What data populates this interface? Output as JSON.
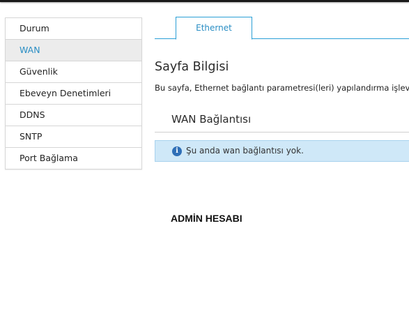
{
  "sidebar": {
    "items": [
      {
        "label": "Durum",
        "active": false
      },
      {
        "label": "WAN",
        "active": true
      },
      {
        "label": "Güvenlik",
        "active": false
      },
      {
        "label": "Ebeveyn Denetimleri",
        "active": false
      },
      {
        "label": "DDNS",
        "active": false
      },
      {
        "label": "SNTP",
        "active": false
      },
      {
        "label": "Port Bağlama",
        "active": false
      }
    ]
  },
  "tabs": [
    {
      "label": "Ethernet",
      "active": true
    }
  ],
  "main": {
    "page_title": "Sayfa Bilgisi",
    "page_description": "Bu sayfa, Ethernet bağlantı parametresi(leri) yapılandırma işlevin",
    "section_title": "WAN Bağlantısı",
    "info_message": "Şu anda wan bağlantısı yok.",
    "info_icon": "info-icon",
    "admin_label": "ADMİN HESABI"
  },
  "colors": {
    "accent": "#2a9fd6",
    "active_text": "#2a8ec4",
    "info_background": "#cfe8f8",
    "sidebar_active_background": "#ececec"
  }
}
